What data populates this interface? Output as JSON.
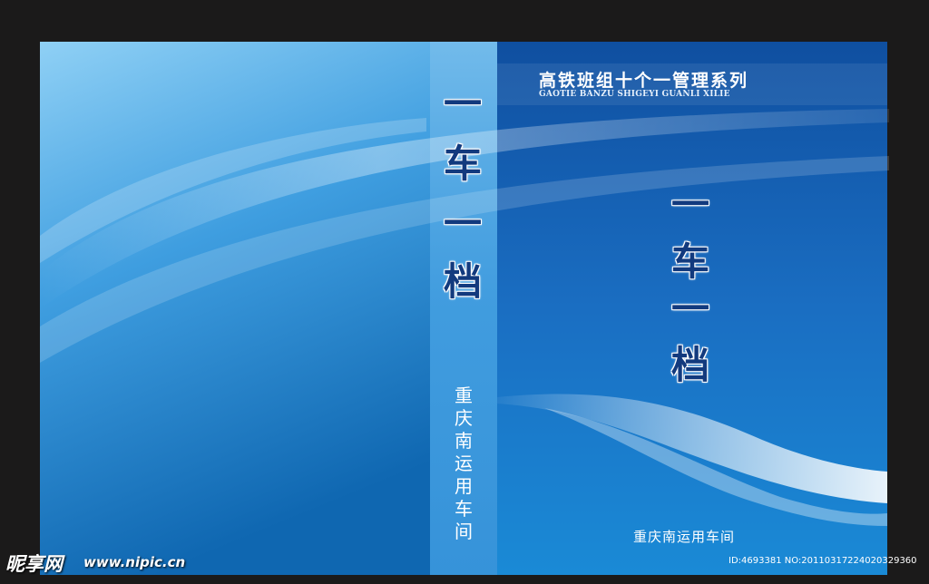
{
  "cover": {
    "series_title_cn": "高铁班组十个一管理系列",
    "series_title_en": "GAOTIE BANZU SHIGEYI GUANLI XILIE",
    "spine_chars": [
      "一",
      "车",
      "一",
      "档"
    ],
    "front_chars": [
      "一",
      "车",
      "一",
      "档"
    ],
    "spine_department": "重庆南运用车间",
    "front_department": "重庆南运用车间"
  },
  "watermark": {
    "logo_text": "昵享网",
    "url": "www.nipic.cn",
    "id_text": "ID:4693381 NO:20110317224020329360"
  },
  "colors": {
    "frame": "#1b1a1a",
    "back_top": "#8fd0f5",
    "back_bottom": "#0f67b1",
    "front_top": "#0f4fa0",
    "front_bottom": "#1a8ad6",
    "title_char": "#123a7e"
  }
}
